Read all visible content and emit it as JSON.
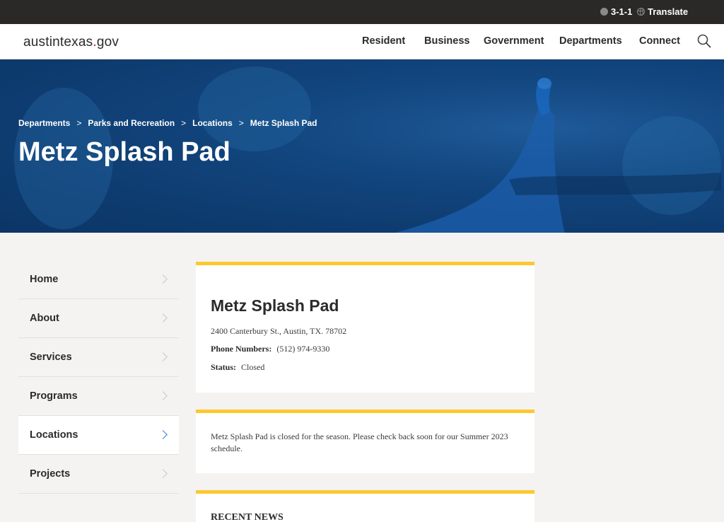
{
  "utility": {
    "phone_label": "3-1-1",
    "translate_label": "Translate"
  },
  "header": {
    "logo_text": "austintexas",
    "logo_dot": ".",
    "logo_tld": "gov",
    "nav": [
      "Resident",
      "Business",
      "Government",
      "Departments",
      "Connect"
    ]
  },
  "hero": {
    "breadcrumb": [
      "Departments",
      "Parks and Recreation",
      "Locations",
      "Metz Splash Pad"
    ],
    "separator": ">",
    "title": "Metz Splash Pad"
  },
  "sidebar": {
    "items": [
      "Home",
      "About",
      "Services",
      "Programs",
      "Locations",
      "Projects"
    ],
    "active": "Locations"
  },
  "location": {
    "title": "Metz Splash Pad",
    "address": "2400 Canterbury St., Austin, TX. 78702",
    "phone_label": "Phone Numbers:",
    "phone": "(512) 974-9330",
    "status_label": "Status:",
    "status": "Closed"
  },
  "notice": {
    "text": "Metz Splash Pad is closed for the season.  Please check back soon for our Summer 2023 schedule."
  },
  "news": {
    "heading": "RECENT NEWS"
  },
  "colors": {
    "accent": "#fdc82f",
    "hero": "#12467f",
    "topbar": "#2a2928",
    "active_chevron": "#3a7fd0"
  }
}
